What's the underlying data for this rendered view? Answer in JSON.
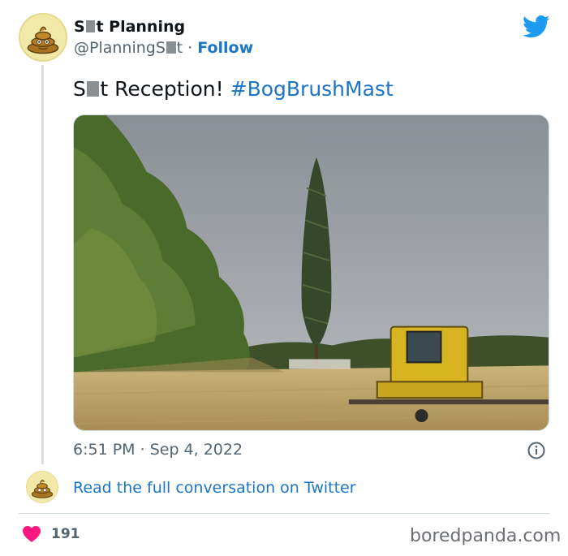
{
  "author": {
    "name_prefix": "S",
    "name_suffix": "t Planning",
    "handle_prefix": "@PlanningS",
    "handle_suffix": "t",
    "separator": "·",
    "follow_label": "Follow"
  },
  "tweet": {
    "text_prefix": "S",
    "text_suffix": "t Reception!",
    "hashtag": "#BogBrushMast",
    "time": "6:51 PM",
    "separator": "·",
    "date": "Sep 4, 2022"
  },
  "thread": {
    "read_link": "Read the full conversation on Twitter"
  },
  "engagement": {
    "likes": "191"
  },
  "watermark": "boredpanda.com",
  "colors": {
    "link_blue": "#1d75c8",
    "twitter_blue": "#1d9bf0",
    "heart_pink": "#f91880",
    "text_gray": "#536471"
  },
  "icons": [
    "poop-emoji-avatar",
    "twitter-bird-icon",
    "info-icon",
    "heart-icon"
  ]
}
